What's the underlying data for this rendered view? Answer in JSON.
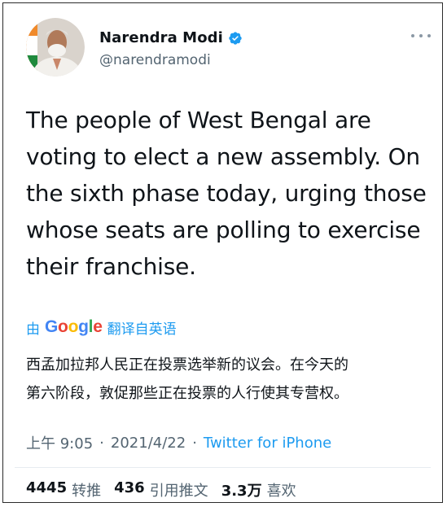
{
  "author": {
    "name": "Narendra Modi",
    "handle": "@narendramodi",
    "verified_color": "#1d9bf0"
  },
  "tweet": {
    "lines": [
      "The people of West Bengal are",
      "voting to elect a new assembly. On",
      "the sixth phase today, urging those",
      "whose seats are polling to exercise",
      "their franchise."
    ]
  },
  "translation": {
    "prefix": "由",
    "brand_letters": [
      "G",
      "o",
      "o",
      "g",
      "l",
      "e"
    ],
    "suffix": "翻译自英语",
    "lines": [
      "西孟加拉邦人民正在投票选举新的议会。在今天的",
      "第六阶段，敦促那些正在投票的人行使其专营权。"
    ]
  },
  "meta": {
    "time": "上午 9:05",
    "separator": "·",
    "date": "2021/4/22",
    "source": "Twitter for iPhone"
  },
  "stats": {
    "retweets_count": "4445",
    "retweets_label": "转推",
    "quotes_count": "436",
    "quotes_label": "引用推文",
    "likes_count": "3.3万",
    "likes_label": "喜欢"
  },
  "colors": {
    "accent": "#1d9bf0",
    "secondary_text": "#536471"
  },
  "icons": {
    "verified": "verified-badge-icon",
    "more": "more-options-icon"
  }
}
